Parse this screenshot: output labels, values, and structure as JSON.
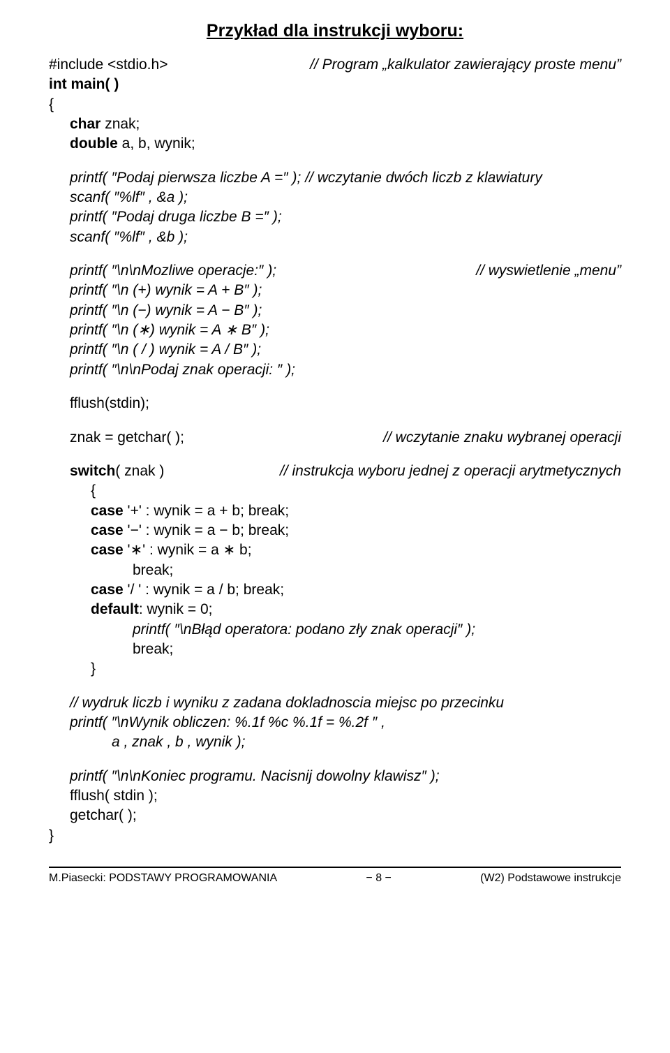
{
  "title": "Przykład dla instrukcji wyboru:",
  "l1a": "#include <stdio.h>",
  "l1b": "// Program „kalkulator zawierający proste menu”",
  "l2": "int main( )",
  "l3": "{",
  "l4": "char  znak;",
  "l5": "double  a, b, wynik;",
  "l6a": "printf( ″Podaj pierwsza liczbe A =″ );",
  "l6b": "// wczytanie dwóch liczb z klawiatury",
  "l7": "scanf( ″%lf″ , &a );",
  "l8": "printf( ″Podaj druga liczbe B =″ );",
  "l9": "scanf( ″%lf″ , &b );",
  "l10a": "printf( ″\\n\\nMozliwe operacje:″ );",
  "l10b": "// wyswietlenie „menu”",
  "l11": "printf( ″\\n  (+)  wynik = A + B″ );",
  "l12": "printf( ″\\n  (−)  wynik = A − B″ );",
  "l13": "printf( ″\\n  (∗)  wynik = A ∗ B″ );",
  "l14": "printf( ″\\n  ( / )  wynik = A / B″ );",
  "l15": "printf( ″\\n\\nPodaj znak operacji: ″ );",
  "l16": "fflush(stdin);",
  "l17a": "znak = getchar( );",
  "l17b": "// wczytanie znaku wybranej operacji",
  "l18a": "switch",
  "l18ab": "( znak )",
  "l18b": "// instrukcja wyboru jednej z operacji arytmetycznych",
  "l19": "{",
  "l20a": "case",
  "l20b": " '+' : wynik = a + b; break;",
  "l21a": "case",
  "l21b": " '−' : wynik = a − b; break;",
  "l22a": "case",
  "l22b": " '∗' : wynik = a ∗ b;",
  "l23": "break;",
  "l24a": "case",
  "l24b": " '/ ' : wynik = a / b; break;",
  "l25a": "default",
  "l25b": ": wynik = 0;",
  "l26": "printf( ″\\nBłąd operatora: podano zły znak operacji″ );",
  "l27": "break;",
  "l28": "}",
  "l29": "// wydruk liczb i wyniku z zadana dokladnoscia miejsc po przecinku",
  "l30": "printf( ″\\nWynik obliczen:   %.1f   %c   %.1f   =  %.2f ″ ,",
  "l31": "a , znak , b , wynik );",
  "l32": "printf( ″\\n\\nKoniec programu. Nacisnij dowolny klawisz″ );",
  "l33": "fflush( stdin );",
  "l34": "getchar( );",
  "l35": "}",
  "footer_left": "M.Piasecki: PODSTAWY PROGRAMOWANIA",
  "footer_mid": "− 8 −",
  "footer_right": "(W2)  Podstawowe instrukcje"
}
